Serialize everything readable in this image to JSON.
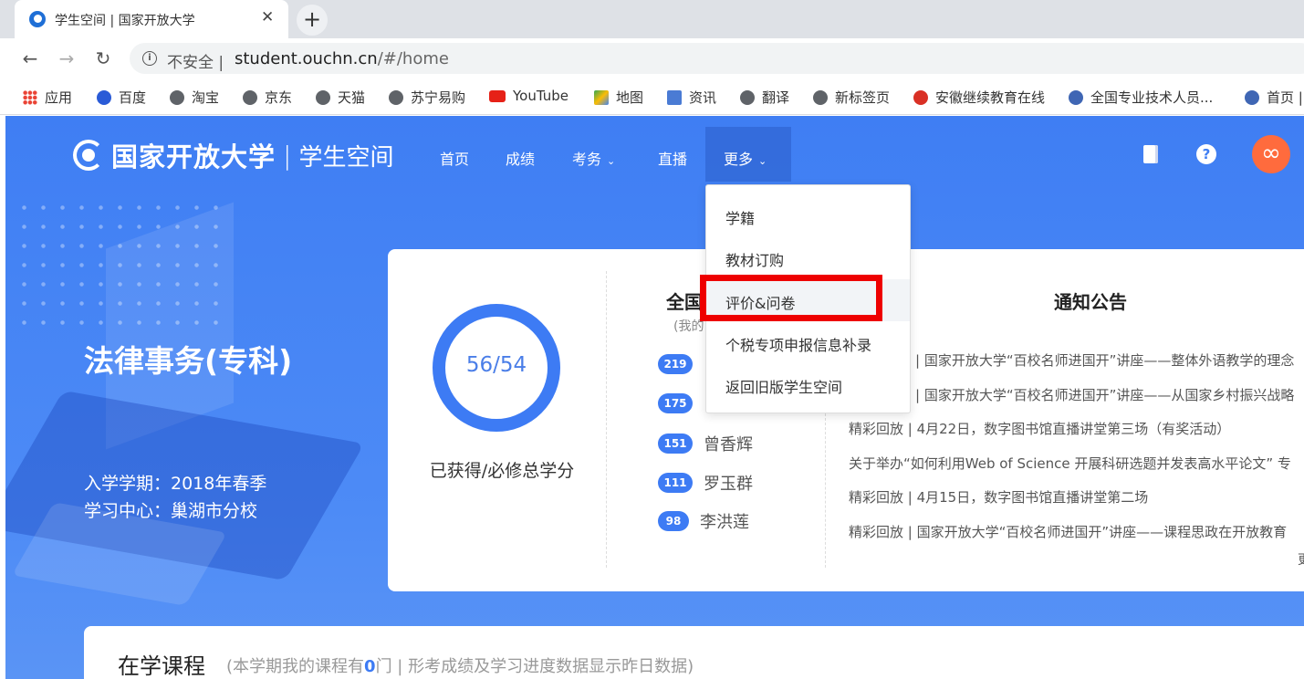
{
  "browser": {
    "tab_title": "学生空间 | 国家开放大学",
    "tab_close": "✕",
    "new_tab": "+",
    "back": "←",
    "forward": "→",
    "reload": "↻",
    "insecure_label": "不安全 |",
    "url_host": "student.ouchn.cn",
    "url_path": "/#/home",
    "bookmarks": [
      {
        "label": "应用",
        "icon": "apps-grid-icon"
      },
      {
        "label": "百度",
        "icon": "baidu-paw-icon"
      },
      {
        "label": "淘宝",
        "icon": "globe-icon"
      },
      {
        "label": "京东",
        "icon": "globe-icon"
      },
      {
        "label": "天猫",
        "icon": "globe-icon"
      },
      {
        "label": "苏宁易购",
        "icon": "globe-icon"
      },
      {
        "label": "YouTube",
        "icon": "youtube-icon"
      },
      {
        "label": "地图",
        "icon": "maps-icon"
      },
      {
        "label": "资讯",
        "icon": "news-icon"
      },
      {
        "label": "翻译",
        "icon": "globe-icon"
      },
      {
        "label": "新标签页",
        "icon": "globe-icon"
      },
      {
        "label": "安徽继续教育在线",
        "icon": "red-logo-icon"
      },
      {
        "label": "全国专业技术人员...",
        "icon": "emblem-icon"
      },
      {
        "label": "首页 |",
        "icon": "ouchn-logo-icon"
      }
    ]
  },
  "header": {
    "logo_name": "国家开放大学",
    "logo_sep": "|",
    "logo_sub": "学生空间",
    "nav": [
      "首页",
      "成绩",
      "考务",
      "直播"
    ],
    "more_label": "更多",
    "caret": "⌄",
    "help_label": "?",
    "avatar_label": "∞"
  },
  "profile": {
    "major": "法律事务(专科)",
    "enroll": "入学学期：2018年春季",
    "center": "学习中心：巢湖市分校"
  },
  "credits": {
    "value": "56/54",
    "label": "已获得/必修总学分"
  },
  "ranking": {
    "title": "全国",
    "subtitle": "(我的",
    "rows": [
      {
        "badge": "219",
        "name": ""
      },
      {
        "badge": "175",
        "name": ""
      },
      {
        "badge": "151",
        "name": "曾香辉"
      },
      {
        "badge": "111",
        "name": "罗玉群"
      },
      {
        "badge": "98",
        "name": "李洪莲"
      }
    ]
  },
  "notices": {
    "title": "通知公告",
    "items": [
      "| 国家开放大学“百校名师进国开”讲座——整体外语教学的理念",
      "| 国家开放大学“百校名师进国开”讲座——从国家乡村振兴战略",
      "精彩回放 | 4月22日，数字图书馆直播讲堂第三场（有奖活动）",
      "关于举办“如何利用Web of Science 开展科研选题并发表高水平论文” 专",
      "精彩回放 | 4月15日，数字图书馆直播讲堂第二场",
      "精彩回放 | 国家开放大学“百校名师进国开”讲座——课程思政在开放教育"
    ],
    "more": "更"
  },
  "dropdown": {
    "items": [
      "学籍",
      "教材订购",
      "评价&问卷",
      "个税专项申报信息补录",
      "返回旧版学生空间"
    ],
    "highlighted_index": 2,
    "highlight_color": "#ee0000"
  },
  "courses": {
    "title": "在学课程",
    "sub_prefix": "(本学期我的课程有",
    "count": "0",
    "sub_suffix": "门 | 形考成绩及学习进度数据显示昨日数据)"
  },
  "colors": {
    "accent": "#3d7bf4",
    "avatar": "#ff6b3d"
  }
}
